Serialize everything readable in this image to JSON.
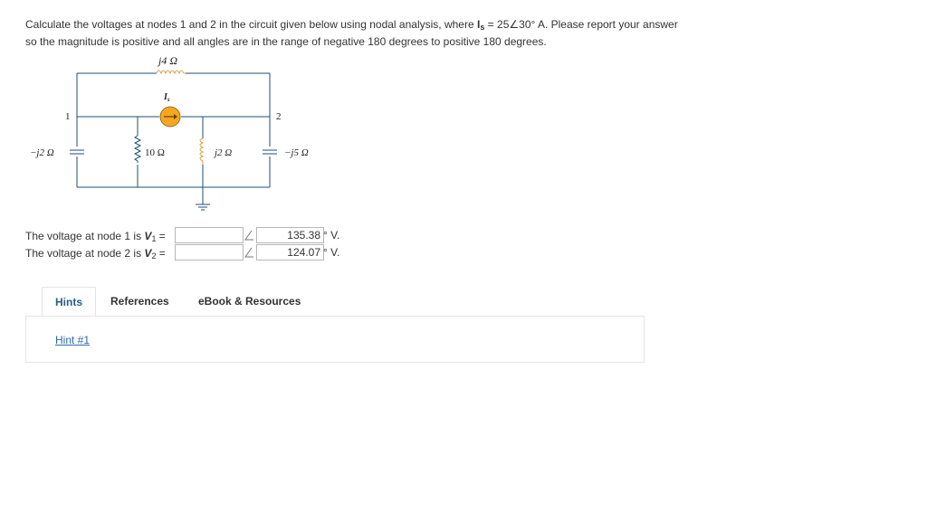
{
  "problem": {
    "text_before": "Calculate the voltages at nodes 1 and 2 in the circuit given below using nodal analysis, where ",
    "is_label": "I",
    "is_sub": "s",
    "is_value": " = 25",
    "angle_symbol": "∠",
    "is_angle": "30° A. Please report your answer so the magnitude is positive and all angles are in the range of negative 180 degrees to positive 180 degrees."
  },
  "circuit": {
    "top_inductor_label": "j4 Ω",
    "source_label": "I",
    "source_sub": "s",
    "node1_label": "1",
    "node2_label": "2",
    "cap_left_label": "−j2 Ω",
    "resistor_label": "10 Ω",
    "inductor_mid_label": "j2 Ω",
    "cap_right_label": "−j5 Ω"
  },
  "answers": [
    {
      "prefix": "The voltage at node 1 is ",
      "var": "V",
      "sub": "1",
      "eq": " =",
      "magnitude_value": "",
      "angle_symbol": "∠",
      "angle_value": "135.38",
      "unit": "° V."
    },
    {
      "prefix": "The voltage at node 2 is ",
      "var": "V",
      "sub": "2",
      "eq": " =",
      "magnitude_value": "",
      "angle_symbol": "∠",
      "angle_value": "124.07",
      "unit": "° V."
    }
  ],
  "tabs": {
    "hints": "Hints",
    "references": "References",
    "ebook": "eBook & Resources"
  },
  "panel": {
    "hint_link": "Hint #1"
  },
  "colors": {
    "wire": "#1f4e79",
    "source_fill": "#f5a623",
    "tab_active_text": "#2b5b8a",
    "link": "#2a6ab3"
  }
}
